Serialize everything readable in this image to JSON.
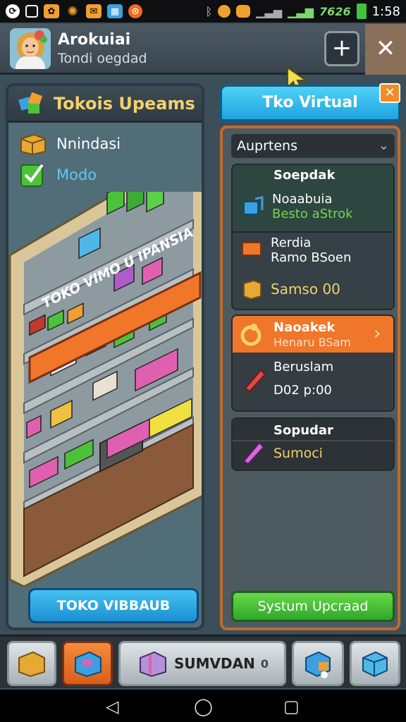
{
  "status_bar": {
    "battery_text": "7626",
    "clock": "1:58"
  },
  "header": {
    "name": "Arokuiai",
    "subtitle": "Tondi oegdad",
    "plus_label": "+",
    "close_label": "✕"
  },
  "left_panel": {
    "title": "Tokois Upeams",
    "items": [
      {
        "label": "Nnindasi",
        "color": "#ffffff"
      },
      {
        "label": "Modo",
        "color": "#5fc8f0"
      }
    ],
    "shelf_sign": "TOKO VIMO U IPANSIA",
    "button_label": "TOKO VIBBAUB"
  },
  "right_panel": {
    "title": "Tko Virtual",
    "close_label": "✕",
    "select_label": "Auprtens",
    "card1": {
      "title": "Soepdak",
      "item1_name": "Noaabuia",
      "item1_sub": "Besto aStrok",
      "item2_name": "Rerdia",
      "item2_sub": "Ramo BSoen",
      "item3_price": "Samso 00"
    },
    "card2": {
      "header_title": "Naoakek",
      "header_sub": "Henaru BSam",
      "item_name": "Beruslam",
      "item_sub": "D02 p:00"
    },
    "card3": {
      "title": "Sopudar",
      "sub": "Sumoci"
    },
    "upgrade_label": "Systum Upcraad"
  },
  "bottom_bar": {
    "center_label": "SUMVDAN",
    "center_suffix": "0"
  },
  "colors": {
    "accent_orange": "#f0762a",
    "accent_blue": "#2ab0ec",
    "accent_green": "#4cc23a",
    "gold": "#f2d16b"
  }
}
